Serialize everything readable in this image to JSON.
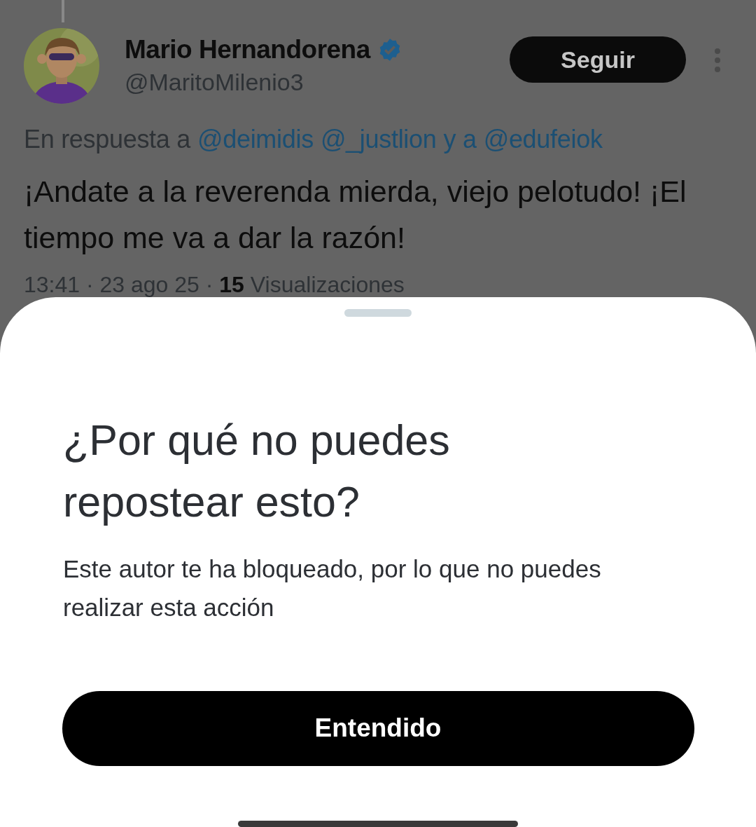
{
  "post": {
    "author": {
      "name": "Mario Hernandorena",
      "verified": true,
      "handle": "@MaritoMilenio3"
    },
    "follow_button": "Seguir",
    "reply_to": [
      {
        "kind": "text",
        "text": "En respuesta a"
      },
      {
        "kind": "link",
        "text": "@deimidis"
      },
      {
        "kind": "link",
        "text": "@_justlion"
      },
      {
        "kind": "joiner",
        "text": "y a"
      },
      {
        "kind": "link",
        "text": "@edufeiok"
      }
    ],
    "text": "¡Andate a la reverenda mierda, viejo pelotudo! ¡El tiempo me va a dar la razón!",
    "meta": "13:41 · 23 ago 25 · **15** Visualizaciones"
  },
  "sheet": {
    "title": "¿Por qué no puedes repostear esto?",
    "body": "Este autor te ha bloqueado, por lo que no puedes realizar esta acción",
    "button": "Entendido"
  }
}
